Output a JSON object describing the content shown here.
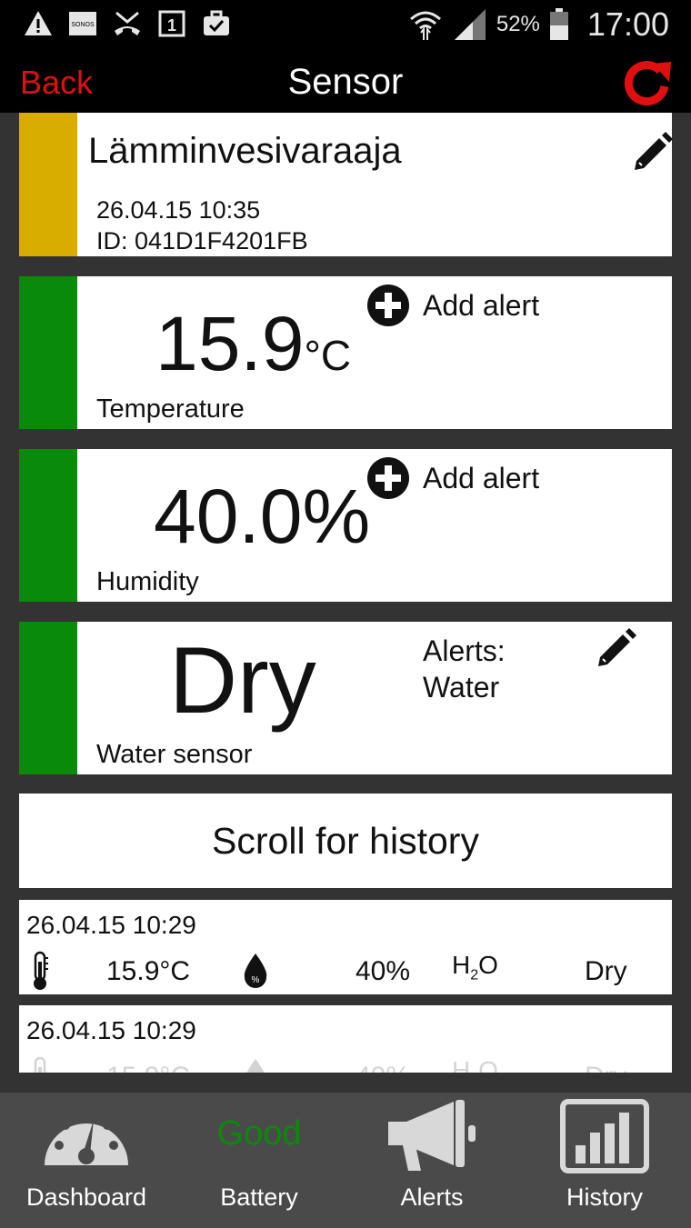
{
  "status_bar": {
    "notification_icons": [
      "warning-icon",
      "sonos-icon",
      "missed-call-icon",
      "calendar-icon",
      "briefcase-icon"
    ],
    "sonos_text": "SONOS",
    "calendar_day": "1",
    "battery_percent": "52%",
    "time": "17:00"
  },
  "header": {
    "back_label": "Back",
    "title": "Sensor",
    "refresh_icon": "refresh-icon"
  },
  "device": {
    "name": "Lämminvesivaraaja",
    "date": "26.04.15  10:35",
    "id": "ID: 041D1F4201FB",
    "strip_color": "#d9ad00"
  },
  "temperature": {
    "value": "15.9",
    "unit": "°C",
    "label": "Temperature",
    "add_alert_label": "Add alert",
    "strip_color": "#0a8a0a"
  },
  "humidity": {
    "value": "40.0%",
    "label": "Humidity",
    "add_alert_label": "Add alert",
    "strip_color": "#0a8a0a"
  },
  "water": {
    "value": "Dry",
    "label": "Water sensor",
    "alerts_title": "Alerts:",
    "alerts_value": "Water",
    "strip_color": "#0a8a0a"
  },
  "scroll_hint": "Scroll for history",
  "history": [
    {
      "time": "26.04.15  10:29",
      "temp": "15.9°C",
      "humidity": "40%",
      "h2o_prefix": "H",
      "h2o_sub": "2",
      "h2o_suffix": "O",
      "water": "Dry"
    },
    {
      "time": "26.04.15  10:29",
      "temp": "15.9°C",
      "humidity": "40%",
      "h2o_prefix": "H",
      "h2o_sub": "2",
      "h2o_suffix": "O",
      "water": "Dry"
    }
  ],
  "bottom_nav": {
    "items": [
      {
        "label": "Dashboard",
        "icon": "gauge-icon"
      },
      {
        "label": "Battery",
        "status": "Good"
      },
      {
        "label": "Alerts",
        "icon": "megaphone-icon"
      },
      {
        "label": "History",
        "icon": "bar-chart-icon"
      }
    ]
  },
  "colors": {
    "accent_red": "#e01010",
    "good_green": "#0a8a0a",
    "device_yellow": "#d9ad00"
  }
}
